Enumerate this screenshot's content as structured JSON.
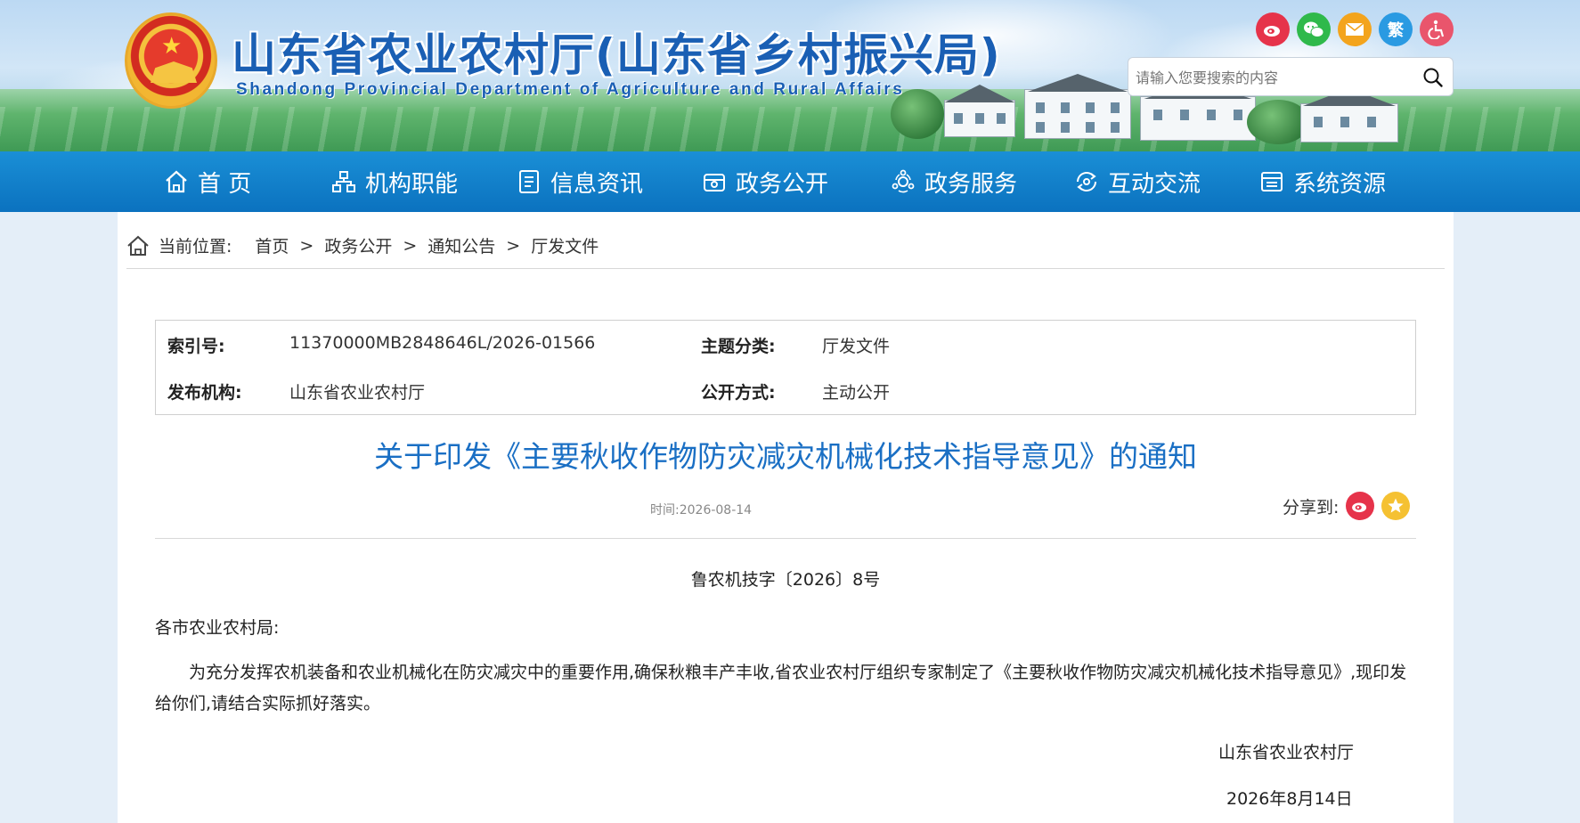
{
  "header": {
    "title": "山东省农业农村厅(山东省乡村振兴局)",
    "subtitle": "Shandong Provincial Department of Agriculture and Rural Affairs",
    "icons": [
      {
        "name": "weibo-icon",
        "color": "#e6334a",
        "glyph": "微"
      },
      {
        "name": "wechat-icon",
        "color": "#2fb94b",
        "glyph": "信"
      },
      {
        "name": "mail-icon",
        "color": "#f3a41d",
        "glyph": "✉"
      },
      {
        "name": "traditional-chinese-icon",
        "color": "#2a9ae2",
        "glyph": "繁"
      },
      {
        "name": "accessibility-icon",
        "color": "#e9556c",
        "glyph": "♿"
      }
    ],
    "search": {
      "placeholder": "请输入您要搜索的内容"
    }
  },
  "nav": {
    "items": [
      {
        "label": "首 页",
        "icon": "home-icon"
      },
      {
        "label": "机构职能",
        "icon": "org-chart-icon"
      },
      {
        "label": "信息资讯",
        "icon": "document-icon"
      },
      {
        "label": "政务公开",
        "icon": "open-box-icon"
      },
      {
        "label": "政务服务",
        "icon": "service-icon"
      },
      {
        "label": "互动交流",
        "icon": "interaction-icon"
      },
      {
        "label": "系统资源",
        "icon": "system-icon"
      }
    ]
  },
  "breadcrumb": {
    "label": "当前位置:",
    "items": [
      "首页",
      "政务公开",
      "通知公告",
      "厅发文件"
    ],
    "sep": ">"
  },
  "meta": {
    "index_key": "索引号:",
    "index_val": "11370000MB2848646L/2026-01566",
    "category_key": "主题分类:",
    "category_val": "厅发文件",
    "publisher_key": "发布机构:",
    "publisher_val": "山东省农业农村厅",
    "disclosure_key": "公开方式:",
    "disclosure_val": "主动公开"
  },
  "article": {
    "title": "关于印发《主要秋收作物防灾减灾机械化技术指导意见》的通知",
    "time": "时间:2026-08-14",
    "share_label": "分享到:",
    "doc_number": "鲁农机技字〔2026〕8号",
    "salutation": "各市农业农村局:",
    "body": "为充分发挥农机装备和农业机械化在防灾减灾中的重要作用,确保秋粮丰产丰收,省农业农村厅组织专家制定了《主要秋收作物防灾减灾机械化技术指导意见》,现印发给你们,请结合实际抓好落实。",
    "sign_org": "山东省农业农村厅",
    "sign_date": "2026年8月14日"
  }
}
